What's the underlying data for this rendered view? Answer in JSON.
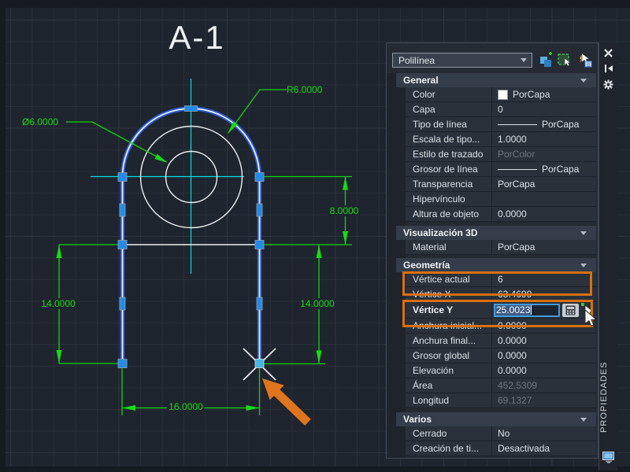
{
  "drawing": {
    "title": "A-1",
    "dims": {
      "diameter": "Ø6.0000",
      "radius": "R6.0000",
      "height8": "8.0000",
      "left14": "14.0000",
      "right14": "14.0000",
      "width16": "16.0000"
    },
    "colors": {
      "dimension_green": "#15dc15",
      "centerline_cyan": "#00dfe6",
      "selection_blue": "#2a56cf",
      "grip_blue": "#1f8ceb",
      "active_grip": "#45b5e5",
      "annotation_orange": "#e0751c",
      "highlight_orange": "#d9700f"
    }
  },
  "panel": {
    "selector": {
      "value": "Polilínea"
    },
    "toolbar": {
      "toggle_pickadd": "toggle-pickadd",
      "select_objects": "select-objects",
      "quick_select": "quick-select"
    },
    "sidebar_title": "PROPIEDADES",
    "sections": [
      {
        "title": "General",
        "rows": [
          {
            "label": "Color",
            "value": "PorCapa"
          },
          {
            "label": "Capa",
            "value": "0"
          },
          {
            "label": "Tipo de línea",
            "value": "PorCapa"
          },
          {
            "label": "Escala de tipo...",
            "value": "1.0000"
          },
          {
            "label": "Estilo de trazado",
            "value": "PorColor"
          },
          {
            "label": "Grosor de línea",
            "value": "PorCapa"
          },
          {
            "label": "Transparencia",
            "value": "PorCapa"
          },
          {
            "label": "Hipervínculo",
            "value": ""
          },
          {
            "label": "Altura de objeto",
            "value": "0.0000"
          }
        ]
      },
      {
        "title": "Visualización 3D",
        "rows": [
          {
            "label": "Material",
            "value": "PorCapa"
          }
        ]
      },
      {
        "title": "Geometría",
        "rows": [
          {
            "label": "Vértice actual",
            "value": "6"
          },
          {
            "label": "Vértice X",
            "value": "63.4699"
          },
          {
            "label": "Vértice Y",
            "value": "25.0023"
          },
          {
            "label": "Anchura inicial...",
            "value": "0.0000"
          },
          {
            "label": "Anchura final...",
            "value": "0.0000"
          },
          {
            "label": "Grosor global",
            "value": "0.0000"
          },
          {
            "label": "Elevación",
            "value": "0.0000"
          },
          {
            "label": "Área",
            "value": "452.5309"
          },
          {
            "label": "Longitud",
            "value": "69.1327"
          }
        ]
      },
      {
        "title": "Varios",
        "rows": [
          {
            "label": "Cerrado",
            "value": "No"
          },
          {
            "label": "Creación de ti...",
            "value": "Desactivada"
          }
        ]
      }
    ]
  }
}
